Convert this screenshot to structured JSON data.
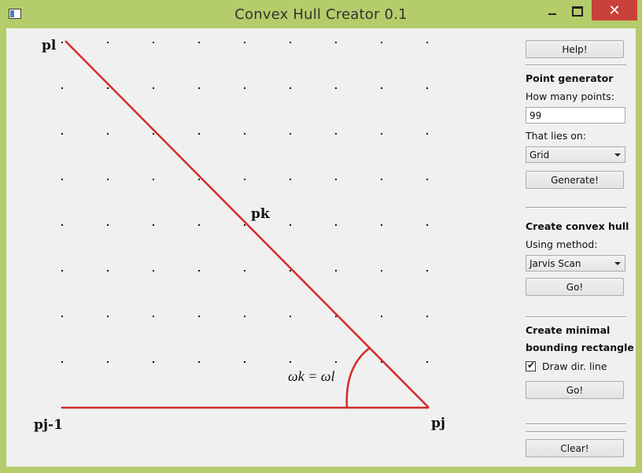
{
  "window": {
    "title": "Convex Hull Creator 0.1",
    "app_icon": "window-app-icon",
    "controls": {
      "minimize": "minimize-icon",
      "maximize": "maximize-icon",
      "close": "✕"
    }
  },
  "canvas": {
    "point_labels": {
      "pl": "pl",
      "pk": "pk",
      "pj_minus_1": "pj-1",
      "pj": "pj"
    },
    "angle_label": "ωk = ωl",
    "hull_color": "#d42a2a",
    "grid_dot_color": "#111111"
  },
  "panel": {
    "help_button": "Help!",
    "point_generator": {
      "title": "Point generator",
      "count_label": "How many points:",
      "count_value": "99",
      "shape_label": "That lies on:",
      "shape_selected": "Grid",
      "generate_button": "Generate!"
    },
    "convex_hull": {
      "title": "Create convex hull",
      "method_label": "Using method:",
      "method_selected": "Jarvis Scan",
      "go_button": "Go!"
    },
    "bounding_rect": {
      "title_line1": "Create minimal",
      "title_line2": "bounding rectangle",
      "draw_dir_label": "Draw dir. line",
      "draw_dir_checked": true,
      "go_button": "Go!"
    },
    "clear_button": "Clear!"
  }
}
